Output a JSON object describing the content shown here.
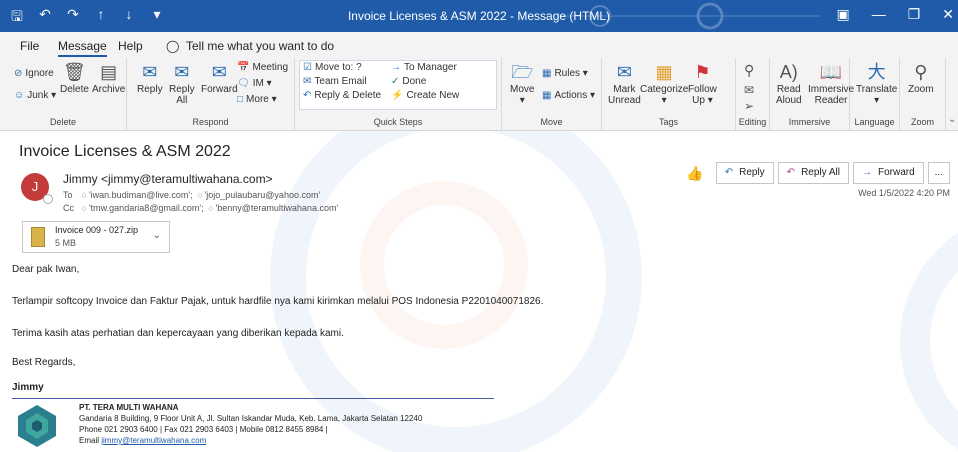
{
  "titlebar": {
    "title": "Invoice Licenses & ASM 2022  -  Message (HTML)"
  },
  "menu": {
    "file": "File",
    "message": "Message",
    "help": "Help",
    "tell_me": "Tell me what you want to do"
  },
  "ribbon": {
    "delete_group": {
      "ignore": "Ignore",
      "junk": "Junk",
      "delete": "Delete",
      "archive": "Archive",
      "label": "Delete"
    },
    "respond_group": {
      "reply": "Reply",
      "reply_all_1": "Reply",
      "reply_all_2": "All",
      "forward": "Forward",
      "meeting": "Meeting",
      "im": "IM",
      "more": "More",
      "label": "Respond"
    },
    "quick_steps": {
      "move_to": "Move to: ?",
      "team_email": "Team Email",
      "reply_delete": "Reply & Delete",
      "to_manager": "To Manager",
      "done": "Done",
      "create_new": "Create New",
      "label": "Quick Steps"
    },
    "move_group": {
      "move": "Move",
      "rules": "Rules",
      "actions": "Actions",
      "label": "Move"
    },
    "tags_group": {
      "mark_unread_1": "Mark",
      "mark_unread_2": "Unread",
      "categorize": "Categorize",
      "follow_up_1": "Follow",
      "follow_up_2": "Up",
      "label": "Tags"
    },
    "editing_group": {
      "label": "Editing"
    },
    "immersive_group": {
      "read_aloud_1": "Read",
      "read_aloud_2": "Aloud",
      "immersive_reader_1": "Immersive",
      "immersive_reader_2": "Reader",
      "label": "Immersive"
    },
    "language_group": {
      "translate": "Translate",
      "label": "Language"
    },
    "zoom_group": {
      "zoom": "Zoom",
      "label": "Zoom"
    }
  },
  "message": {
    "subject": "Invoice Licenses & ASM 2022",
    "avatar_initial": "J",
    "from": "Jimmy <jimmy@teramultiwahana.com>",
    "to_label": "To",
    "to": [
      "'iwan.budiman@live.com';",
      "'jojo_pulaubaru@yahoo.com'"
    ],
    "cc_label": "Cc",
    "cc": [
      "'tmw.gandaria8@gmail.com';",
      "'benny@teramultiwahana.com'"
    ],
    "reply": "Reply",
    "reply_all": "Reply All",
    "forward": "Forward",
    "more": "...",
    "date": "Wed 1/5/2022 4:20 PM",
    "attachment": {
      "name": "Invoice 009 - 027.zip",
      "size": "5 MB"
    }
  },
  "body": {
    "greeting": "Dear pak Iwan,",
    "line1": "Terlampir softcopy Invoice dan Faktur Pajak, untuk hardfile nya kami kirimkan melalui POS Indonesia P2201040071826.",
    "line2": "Terima kasih atas perhatian dan kepercayaan yang diberikan kepada kami.",
    "regards": "Best Regards,",
    "name": "Jimmy"
  },
  "signature": {
    "company": "PT. TERA MULTI WAHANA",
    "address": "Gandaria 8 Building, 9 Floor Unit A, Jl. Sultan Iskandar Muda, Keb. Lama, Jakarta Selatan 12240",
    "phone": "Phone 021 2903 6400 | Fax 021 2903 6403 | Mobile 0812 8455 8984 |",
    "email_label": "Email",
    "email": "jimmy@teramultiwahana.com"
  },
  "colors": {
    "titlebar": "#1f5ba8",
    "accent": "#2b6cb0",
    "avatar": "#c43b3b"
  }
}
